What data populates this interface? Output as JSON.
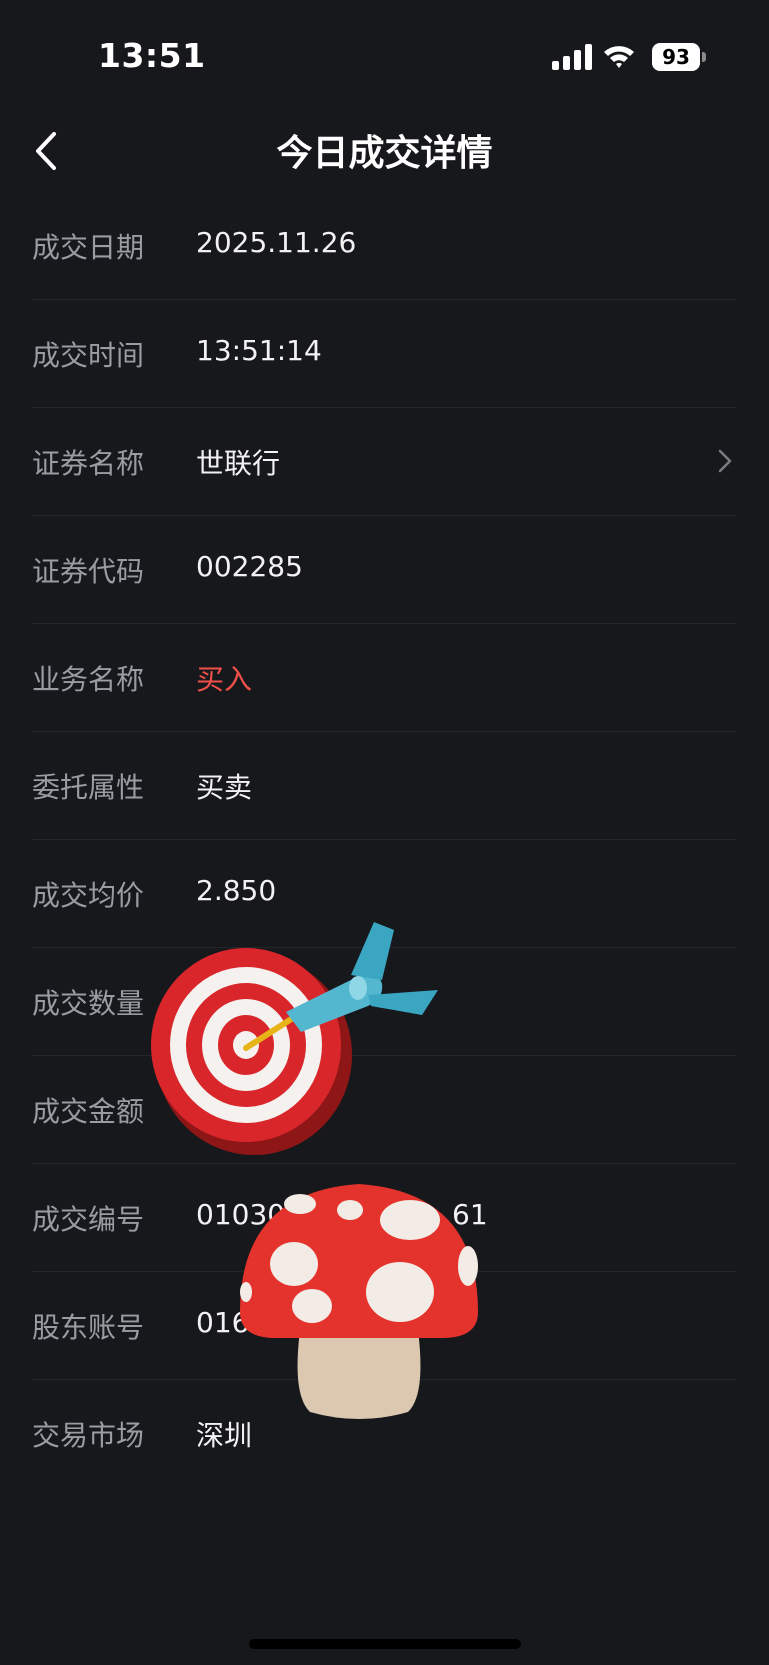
{
  "status_bar": {
    "time": "13:51",
    "battery": "93",
    "icons": [
      "signal-icon",
      "wifi-icon",
      "battery-icon"
    ]
  },
  "nav": {
    "title": "今日成交详情",
    "back_icon": "chevron-left-icon"
  },
  "rows": [
    {
      "label": "成交日期",
      "value": "2025.11.26"
    },
    {
      "label": "成交时间",
      "value": "13:51:14"
    },
    {
      "label": "证券名称",
      "value": "世联行"
    },
    {
      "label": "证券代码",
      "value": "002285"
    },
    {
      "label": "业务名称",
      "value": "买入"
    },
    {
      "label": "委托属性",
      "value": "买卖"
    },
    {
      "label": "成交均价",
      "value": "2.850"
    },
    {
      "label": "成交数量",
      "value": ""
    },
    {
      "label": "成交金额",
      "value": ""
    },
    {
      "label": "成交编号",
      "value": "01030",
      "value_tail": "61"
    },
    {
      "label": "股东账号",
      "value": "0169"
    },
    {
      "label": "交易市场",
      "value": "深圳"
    }
  ],
  "colors": {
    "background": "#17181c",
    "label": "#9a9ca3",
    "value": "#f2f2f2",
    "buy_red": "#f0504a",
    "divider": "#24262b"
  },
  "stickers": [
    "dart-target-sticker",
    "mushroom-sticker"
  ]
}
